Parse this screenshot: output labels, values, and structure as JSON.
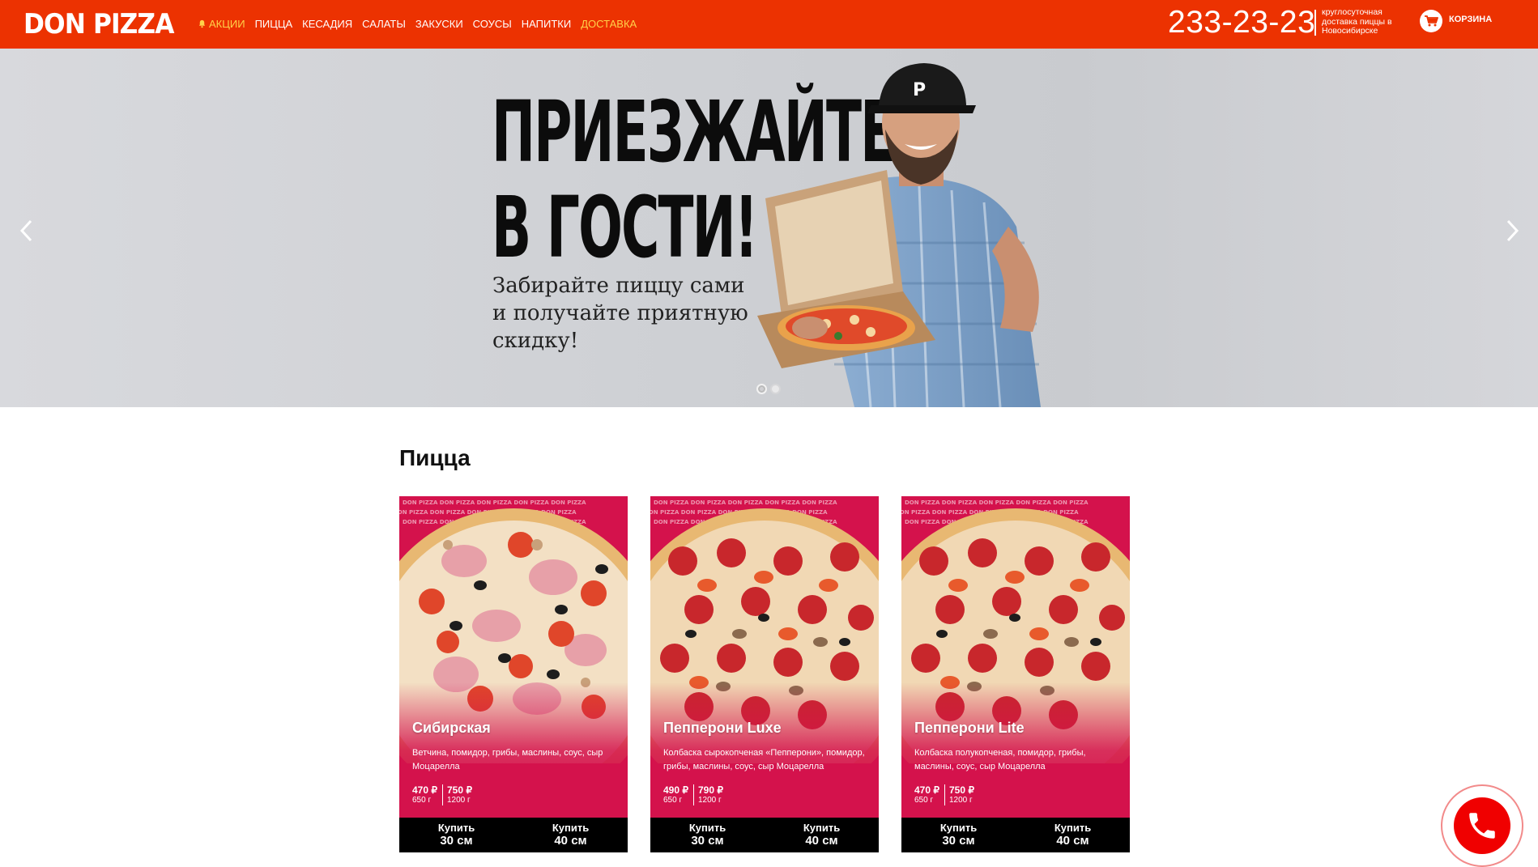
{
  "header": {
    "logo": "DON PIZZA",
    "nav": [
      {
        "label": "Акции",
        "accent": true,
        "icon": "bell-icon"
      },
      {
        "label": "Пицца",
        "accent": false
      },
      {
        "label": "Кесадия",
        "accent": false
      },
      {
        "label": "Салаты",
        "accent": false
      },
      {
        "label": "Закуски",
        "accent": false
      },
      {
        "label": "Соусы",
        "accent": false
      },
      {
        "label": "Напитки",
        "accent": false
      },
      {
        "label": "Доставка",
        "accent": true
      }
    ],
    "phone": "233-23-23",
    "phone_note": "круглосуточная доставка пиццы в Новосибирске",
    "cart_label": "Корзина",
    "cart_icon": "cart-icon"
  },
  "hero": {
    "title_line1": "ПРИЕЗЖАЙТЕ",
    "title_line2": "В ГОСТИ!",
    "subtitle": "Забирайте пиццу сами и получайте приятную скидку!",
    "slides_total": 2,
    "active_slide": 1
  },
  "section": {
    "title": "Пицца"
  },
  "products": [
    {
      "name": "Сибирская",
      "description": "Ветчина, помидор, грибы, маслины, соус, сыр Моцарелла",
      "prices": [
        {
          "price": "470 ₽",
          "weight": "650 г"
        },
        {
          "price": "750 ₽",
          "weight": "1200 г"
        }
      ],
      "buttons": [
        {
          "top": "Купить",
          "bottom": "30 см"
        },
        {
          "top": "Купить",
          "bottom": "40 см"
        }
      ]
    },
    {
      "name": "Пепперони Luxe",
      "description": "Колбаска сырокопченая «Пепперони», помидор, грибы, маслины, соус, сыр Моцарелла",
      "prices": [
        {
          "price": "490 ₽",
          "weight": "650 г"
        },
        {
          "price": "790 ₽",
          "weight": "1200 г"
        }
      ],
      "buttons": [
        {
          "top": "Купить",
          "bottom": "30 см"
        },
        {
          "top": "Купить",
          "bottom": "40 см"
        }
      ]
    },
    {
      "name": "Пепперони Lite",
      "description": "Колбаска полукопченая, помидор, грибы, маслины, соус, сыр Моцарелла",
      "prices": [
        {
          "price": "470 ₽",
          "weight": "650 г"
        },
        {
          "price": "750 ₽",
          "weight": "1200 г"
        }
      ],
      "buttons": [
        {
          "top": "Купить",
          "bottom": "30 см"
        },
        {
          "top": "Купить",
          "bottom": "40 см"
        }
      ]
    }
  ],
  "colors": {
    "header_bg": "#ec3201",
    "nav_accent": "#ffd24a",
    "card_bg": "#d4124c",
    "buy_bar": "#000000",
    "call_button": "#f00000"
  },
  "call_widget_icon": "phone-icon"
}
